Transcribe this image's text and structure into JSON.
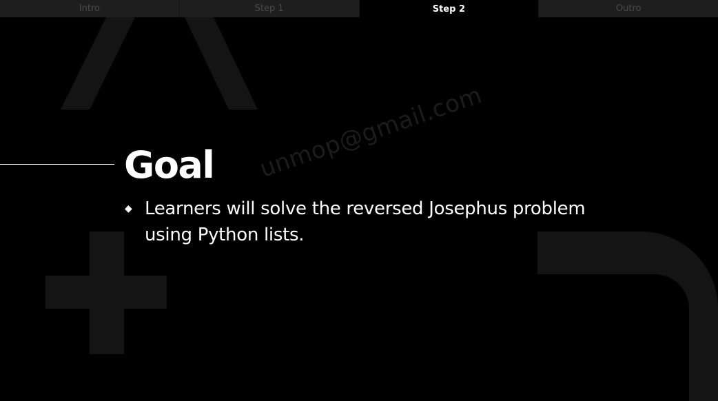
{
  "tabs": [
    {
      "label": "Intro",
      "active": false
    },
    {
      "label": "Step 1",
      "active": false
    },
    {
      "label": "Step 2",
      "active": true
    },
    {
      "label": "Outro",
      "active": false
    }
  ],
  "slide": {
    "title": "Goal",
    "bullets": [
      "Learners will solve the reversed Josephus problem using Python lists."
    ],
    "watermark": "unmop@gmail.com"
  },
  "icons": {
    "bullet": "diamond-bullet-icon"
  },
  "colors": {
    "background": "#000000",
    "tab_inactive_bg": "#1e1e1e",
    "tab_inactive_text": "#4a4a4a",
    "tab_active_bg": "#000000",
    "tab_active_text": "#ffffff",
    "text": "#ffffff",
    "decoration": "#141414"
  }
}
